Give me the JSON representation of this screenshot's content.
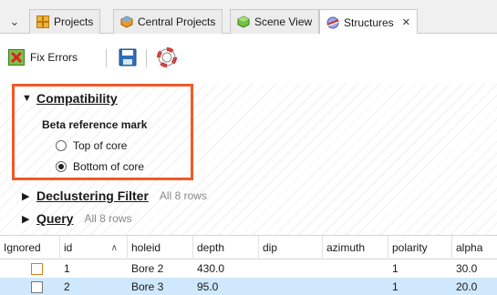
{
  "tabs": [
    {
      "label": "Projects",
      "icon": "projects-grid-icon",
      "active": false
    },
    {
      "label": "Central Projects",
      "icon": "central-projects-icon",
      "active": false
    },
    {
      "label": "Scene View",
      "icon": "scene-view-cube-icon",
      "active": false
    },
    {
      "label": "Structures",
      "icon": "structures-icon",
      "active": true,
      "close": "✕"
    }
  ],
  "toolbar": {
    "fix_errors_label": "Fix Errors",
    "save_icon": "save-icon",
    "help_icon": "lifebuoy-icon"
  },
  "compatibility": {
    "title": "Compatibility",
    "subtitle": "Beta reference mark",
    "options": [
      {
        "label": "Top of core",
        "selected": false
      },
      {
        "label": "Bottom of core",
        "selected": true
      }
    ]
  },
  "declustering": {
    "title": "Declustering Filter",
    "meta": "All 8 rows"
  },
  "query": {
    "title": "Query",
    "meta": "All 8 rows"
  },
  "table": {
    "columns": [
      "Ignored",
      "id",
      "holeid",
      "depth",
      "dip",
      "azimuth",
      "polarity",
      "alpha"
    ],
    "rows": [
      {
        "ignored": false,
        "id": "1",
        "holeid": "Bore 2",
        "depth": "430.0",
        "dip": "",
        "azimuth": "",
        "polarity": "1",
        "alpha": "30.0"
      },
      {
        "ignored": false,
        "id": "2",
        "holeid": "Bore 3",
        "depth": "95.0",
        "dip": "",
        "azimuth": "",
        "polarity": "1",
        "alpha": "20.0"
      }
    ]
  },
  "colors": {
    "highlight": "#f15a24",
    "selection": "#cfe8fc"
  }
}
